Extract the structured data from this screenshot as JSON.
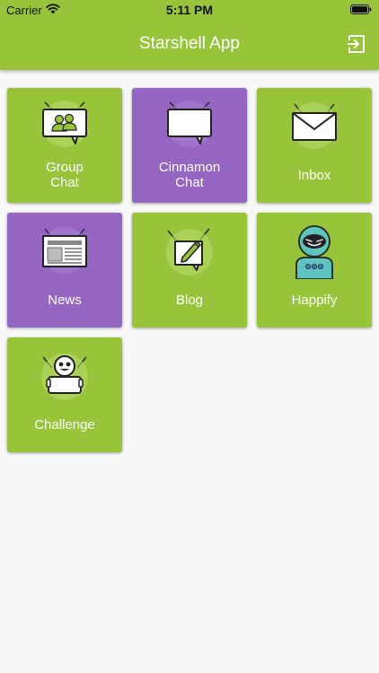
{
  "status_bar": {
    "carrier": "Carrier",
    "time": "5:11 PM"
  },
  "header": {
    "title": "Starshell App",
    "logout_icon": "logout-icon"
  },
  "colors": {
    "green": "#97c43b",
    "purple": "#9565c2",
    "background": "#f8f8f8"
  },
  "tiles": [
    {
      "label": "Group\nChat",
      "icon": "group-chat-icon",
      "color": "green"
    },
    {
      "label": "Cinnamon\nChat",
      "icon": "chat-bubble-icon",
      "color": "purple"
    },
    {
      "label": "Inbox",
      "icon": "envelope-icon",
      "color": "green"
    },
    {
      "label": "News",
      "icon": "newspaper-icon",
      "color": "purple"
    },
    {
      "label": "Blog",
      "icon": "pencil-note-icon",
      "color": "green"
    },
    {
      "label": "Happify",
      "icon": "robot-icon",
      "color": "green"
    },
    {
      "label": "Challenge",
      "icon": "challenge-robot-icon",
      "color": "green"
    }
  ]
}
